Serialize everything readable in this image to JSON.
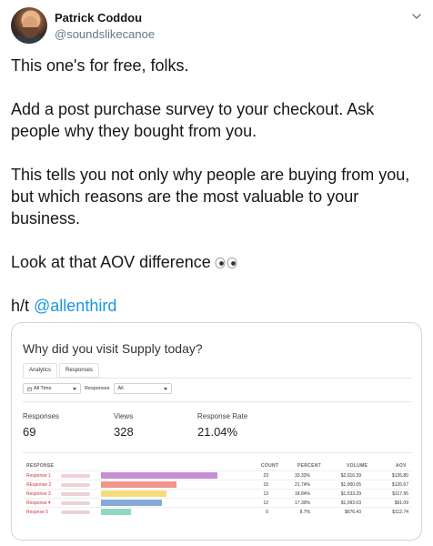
{
  "author": {
    "name": "Patrick Coddou",
    "handle": "@soundslikecanoe"
  },
  "tweet": {
    "p1": "This one's for free, folks.",
    "p2": "Add a post purchase survey to your checkout. Ask people why they bought from you.",
    "p3": "This tells you not only why people are buying from you, but which reasons are the most valuable to your business.",
    "p4": "Look at that AOV difference",
    "ht_prefix": "h/t ",
    "mention": "@allenthird",
    "eyes_icon": "eyes-emoji-icon"
  },
  "card": {
    "title": "Why did you visit Supply today?",
    "tabs": [
      "Analytics",
      "Responses"
    ],
    "filters": {
      "date": "All Time",
      "responses_label": "Responses",
      "responses_value": "All"
    },
    "stats": [
      {
        "label": "Responses",
        "value": "69"
      },
      {
        "label": "Views",
        "value": "328"
      },
      {
        "label": "Response Rate",
        "value": "21.04%"
      }
    ],
    "table": {
      "headers": [
        "RESPONSE",
        "COUNT",
        "PERCENT",
        "VOLUME",
        "AOV"
      ],
      "rows": [
        {
          "label": "Response 1",
          "count": "23",
          "percent": "33.33%",
          "percent_value": 33.33,
          "volume": "$2,916.39",
          "aov": "$126.80",
          "color": "#c48fd6"
        },
        {
          "label": "REsponse 2",
          "count": "15",
          "percent": "21.74%",
          "percent_value": 21.74,
          "volume": "$1,900.05",
          "aov": "$126.67",
          "color": "#f2958a"
        },
        {
          "label": "Response 3",
          "count": "13",
          "percent": "18.84%",
          "percent_value": 18.84,
          "volume": "$1,533.29",
          "aov": "$117.95",
          "color": "#f6dd7a"
        },
        {
          "label": "Response 4",
          "count": "12",
          "percent": "17.39%",
          "percent_value": 17.39,
          "volume": "$1,093.03",
          "aov": "$91.09",
          "color": "#86a9d9"
        },
        {
          "label": "Respnse 5",
          "count": "6",
          "percent": "8.7%",
          "percent_value": 8.7,
          "volume": "$676.43",
          "aov": "$112.74",
          "color": "#8fd9c4"
        }
      ]
    }
  }
}
